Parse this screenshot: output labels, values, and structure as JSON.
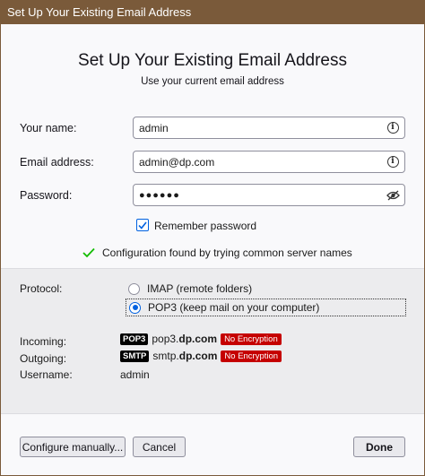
{
  "window": {
    "title": "Set Up Your Existing Email Address"
  },
  "header": {
    "title": "Set Up Your Existing Email Address",
    "subtitle": "Use your current email address"
  },
  "form": {
    "name_label": "Your name:",
    "name_value": "admin",
    "email_label": "Email address:",
    "email_value": "admin@dp.com",
    "password_label": "Password:",
    "password_value": "●●●●●●",
    "remember_label": "Remember password",
    "remember_checked": true
  },
  "status": {
    "message": "Configuration found by trying common server names"
  },
  "config": {
    "protocol_label": "Protocol:",
    "options": [
      {
        "label": "IMAP (remote folders)",
        "selected": false
      },
      {
        "label": "POP3 (keep mail on your computer)",
        "selected": true
      }
    ],
    "incoming_label": "Incoming:",
    "incoming_tag": "POP3",
    "incoming_host_prefix": "pop3.",
    "incoming_host_domain": "dp.com",
    "incoming_encryption": "No Encryption",
    "outgoing_label": "Outgoing:",
    "outgoing_tag": "SMTP",
    "outgoing_host_prefix": "smtp.",
    "outgoing_host_domain": "dp.com",
    "outgoing_encryption": "No Encryption",
    "username_label": "Username:",
    "username_value": "admin"
  },
  "buttons": {
    "configure": "Configure manually...",
    "cancel": "Cancel",
    "done": "Done"
  },
  "icons": {
    "info": "info-icon",
    "eye": "eye-slash-icon",
    "check": "checkmark-icon"
  },
  "colors": {
    "titlebar": "#7a5a3a",
    "accent": "#0061e0",
    "success": "#12bc00",
    "warning": "#c50000"
  }
}
